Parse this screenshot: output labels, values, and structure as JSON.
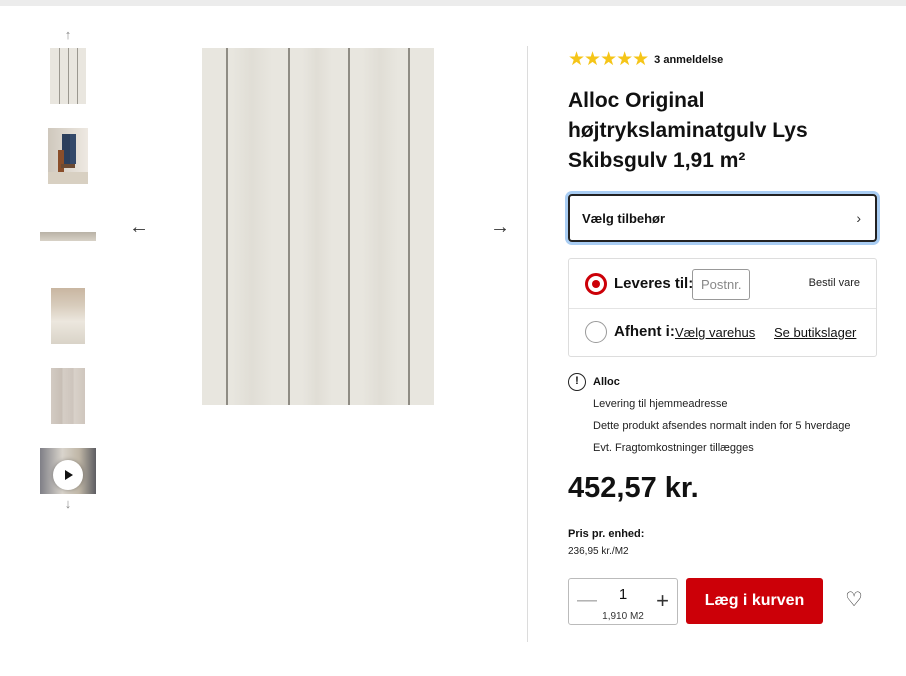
{
  "product": {
    "rating": 4.5,
    "review_count_label": "3 anmeldelse",
    "title": "Alloc Original højtrykslaminatgulv Lys Skibsgulv 1,91 m²",
    "accessory_label": "Vælg tilbehør"
  },
  "delivery": {
    "ship_label": "Leveres til:",
    "postnr_placeholder": "Postnr.",
    "order_item_label": "Bestil vare",
    "pickup_label": "Afhent i:",
    "choose_store_link": "Vælg varehus",
    "store_stock_link": "Se butikslager"
  },
  "info": {
    "icon": "exclamation-circle-icon",
    "supplier": "Alloc",
    "lines": [
      "Levering til hjemmeadresse",
      "Dette produkt afsendes normalt inden for 5 hverdage",
      "Evt. Fragtomkostninger tillægges"
    ]
  },
  "pricing": {
    "price": "452,57 kr.",
    "unit_price_title": "Pris pr. enhed:",
    "unit_price_value": "236,95 kr./M2"
  },
  "purchase": {
    "quantity": "1",
    "quantity_unit": "1,910 M2",
    "add_to_cart_label": "Læg i kurven"
  },
  "gallery": {
    "thumbnails": [
      "flooring-top-view",
      "person-on-floor",
      "plank-profile",
      "room-floor",
      "plank-closeup",
      "video"
    ],
    "icons": {
      "up": "↑",
      "down": "↓",
      "prev": "←",
      "next": "→",
      "chevron": "›",
      "minus": "—",
      "plus": "+",
      "heart": "♡",
      "stars": "★★★★★"
    }
  }
}
